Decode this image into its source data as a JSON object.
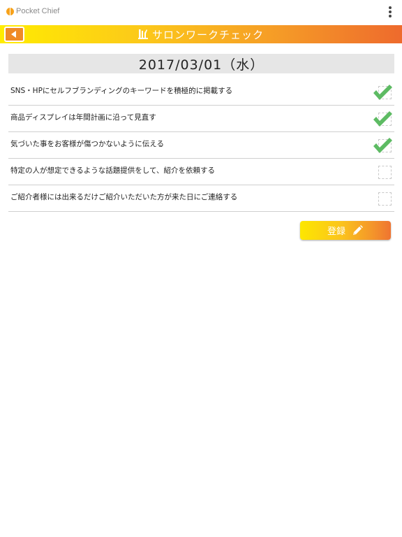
{
  "app": {
    "name": "Pocket Chief",
    "logo": "orange-circle-logo-icon",
    "menu_icon": "more-vert-icon"
  },
  "header": {
    "title": "サロンワークチェック",
    "title_icon": "tools-icon",
    "back_icon": "back-arrow-icon"
  },
  "date": "2017/03/01（水）",
  "checklist": {
    "items": [
      {
        "label": "SNS・HPにセルフブランディングのキーワードを積極的に掲載する",
        "checked": true
      },
      {
        "label": "商品ディスプレイは年間計画に沿って見直す",
        "checked": true
      },
      {
        "label": "気づいた事をお客様が傷つかないように伝える",
        "checked": true
      },
      {
        "label": "特定の人が想定できるような話題提供をして、紹介を依頼する",
        "checked": false
      },
      {
        "label": "ご紹介者様には出来るだけご紹介いただいた方が来た日にご連絡する",
        "checked": false
      }
    ]
  },
  "actions": {
    "register_label": "登録",
    "register_icon": "pencil-icon"
  },
  "colors": {
    "accent_yellow": "#ffec00",
    "accent_orange": "#ee6a2d",
    "check_green": "#5dbb63",
    "date_bg": "#e6e6e6"
  }
}
